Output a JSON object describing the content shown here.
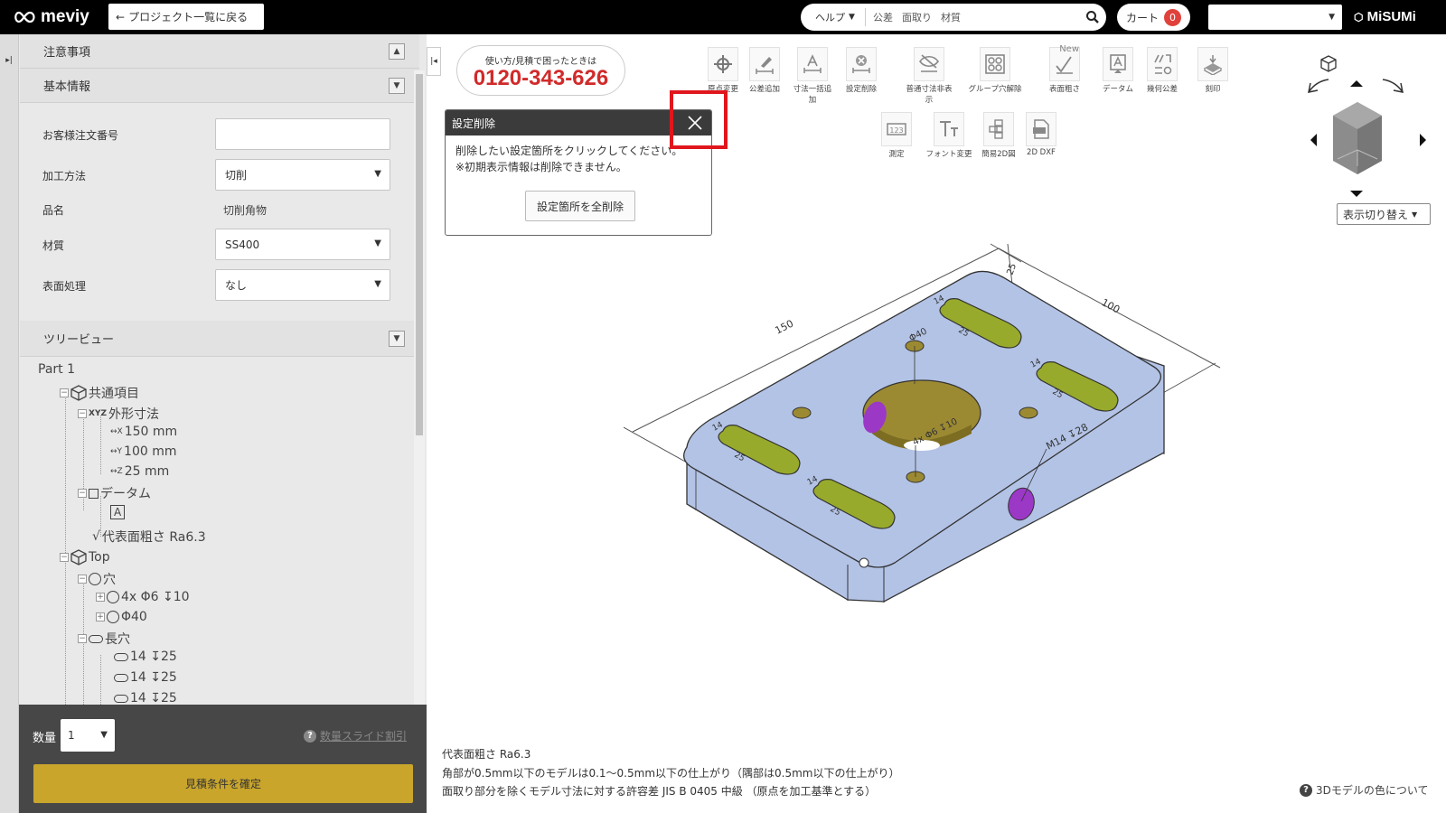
{
  "header": {
    "logo": "meviy",
    "back_button": "プロジェクト一覧に戻る",
    "help_label": "ヘルプ",
    "search_terms": [
      "公差",
      "面取り",
      "材質"
    ],
    "cart_label": "カート",
    "cart_count": "0",
    "brand": "MiSUMi"
  },
  "sidebar": {
    "sections": {
      "notes": "注意事項",
      "basic_info": "基本情報",
      "tree_view": "ツリービュー"
    },
    "form": {
      "order_no_label": "お客様注文番号",
      "order_no_value": "",
      "method_label": "加工方法",
      "method_value": "切削",
      "name_label": "品名",
      "name_value": "切削角物",
      "material_label": "材質",
      "material_value": "SS400",
      "surface_label": "表面処理",
      "surface_value": "なし"
    },
    "tree": {
      "root": "Part 1",
      "common": "共通項目",
      "xyz_icon": "XYZ",
      "outer_dims": "外形寸法",
      "dim_x_axis": "X",
      "dim_x": "150 mm",
      "dim_y_axis": "Y",
      "dim_y": "100 mm",
      "dim_z_axis": "Z",
      "dim_z": "25 mm",
      "datum": "データム",
      "datum_a": "A",
      "roughness": "代表面粗さ Ra6.3",
      "top": "Top",
      "hole": "穴",
      "hole_1": "4x Φ6 ↧10",
      "hole_2": "Φ40",
      "slot": "長穴",
      "slot_1": "14 ↧25",
      "slot_2": "14 ↧25",
      "slot_3": "14 ↧25"
    },
    "bottom": {
      "qty_label": "数量",
      "qty_value": "1",
      "slide_discount": "数量スライド割引",
      "confirm_button": "見積条件を確定"
    }
  },
  "main": {
    "phone_caption": "使い方/見積で困ったときは",
    "phone_number": "0120-343-626",
    "tools_row1": [
      {
        "label": "原点変更",
        "icon": "crosshair-icon"
      },
      {
        "label": "公差追加",
        "icon": "pencil-dimension-icon"
      },
      {
        "label": "寸法一括追加",
        "icon": "dimension-a-icon"
      },
      {
        "label": "設定削除",
        "icon": "delete-setting-icon"
      },
      {
        "label": "普通寸法非表示",
        "icon": "eye-off-icon"
      },
      {
        "label": "グループ穴解除",
        "icon": "hole-group-icon"
      },
      {
        "label": "表面粗さ",
        "icon": "roughness-icon"
      },
      {
        "label": "データム",
        "icon": "datum-icon"
      },
      {
        "label": "幾何公差",
        "icon": "geometric-tolerance-icon"
      },
      {
        "label": "刻印",
        "icon": "stamp-icon"
      }
    ],
    "new_badge": "New",
    "tools_row2": [
      {
        "label": "測定",
        "icon": "measure-icon"
      },
      {
        "label": "フォント変更",
        "icon": "font-icon"
      },
      {
        "label": "簡易2D図",
        "icon": "2d-views-icon"
      },
      {
        "label": "2D DXF",
        "icon": "dxf-icon"
      }
    ],
    "panel": {
      "title": "設定削除",
      "line1": "削除したい設定箇所をクリックしてください。",
      "line2": "※初期表示情報は削除できません。",
      "delete_all_button": "設定箇所を全削除"
    },
    "view_switch": "表示切り替え",
    "model": {
      "dim_150": "150",
      "dim_100": "100",
      "dim_25": "25",
      "phi40": "Φ40",
      "hole_note": "4x Φ6 ↧10",
      "tap_note": "M14 ↧28",
      "slot_w": "14",
      "slot_d": "25"
    },
    "notes": [
      "代表面粗さ Ra6.3",
      "角部が0.5mm以下のモデルは0.1～0.5mm以下の仕上がり（隅部は0.5mm以下の仕上がり）",
      "面取り部分を除くモデル寸法に対する許容差 JIS B 0405 中級 （原点を加工基準とする）"
    ],
    "color_link": "3Dモデルの色について"
  }
}
